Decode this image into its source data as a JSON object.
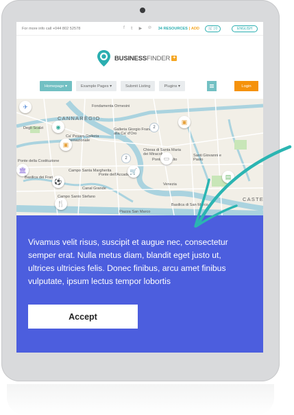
{
  "topbar": {
    "info_text": "For more info call  +044 802 52578",
    "social_icons": [
      "facebook-icon",
      "twitter-icon",
      "youtube-icon",
      "pinterest-icon"
    ],
    "resources_label": "34 RESOURCES",
    "add_label": "ADD",
    "cart_label": "0",
    "language_label": "ENGLISH"
  },
  "logo": {
    "text_bold": "BUSINESS",
    "text_rest": "FINDER",
    "plus": "+"
  },
  "nav": {
    "items": [
      {
        "label": "Homepage ▾"
      },
      {
        "label": "Example Pages ▾"
      },
      {
        "label": "Submit Listing"
      },
      {
        "label": "Plugins ▾"
      }
    ],
    "login_label": "Login"
  },
  "map": {
    "labels": {
      "cannaregio": "CANNAREGIO",
      "fondamenta": "Fondamenta Ormesini",
      "scalzi": "Degli Scalzi",
      "galleria": "Galleria Giorgio Franchetti alla Ca' d'Oro",
      "pesaro": "Ca' Pesaro Galleria Internazionale",
      "rialto": "Ponte di Rialto",
      "santiago": "Santi Giovanni e Paolo",
      "miracoli": "Chiesa di Santa Maria dei Miracoli",
      "costituzione": "Ponte della Costituzione",
      "margherita": "Campo Santa Margherita",
      "basilica": "Basilica dei Frari",
      "canal": "Canal Grande",
      "venezia": "Venezia",
      "sanmarco": "Basilica di San Marco",
      "piazza": "Piazza San Marco",
      "castello": "CASTE",
      "stefano": "Campo Santo Stefano",
      "ponte_accademia": "Ponte dell'Accademia"
    },
    "clusters": [
      "2",
      "2"
    ]
  },
  "consent": {
    "text": "Vivamus velit risus, suscipit et augue nec, consectetur semper erat. Nulla metus diam, blandit eget justo ut, ultrices ultricies felis. Donec finibus, arcu amet finibus vulputate, ipsum lectus tempor lobortis",
    "accept_label": "Accept"
  },
  "colors": {
    "accent_teal": "#2aaeb0",
    "consent_bg": "#4c5ede",
    "login_orange": "#f5920c",
    "arrow_teal": "#2bb5b2"
  }
}
